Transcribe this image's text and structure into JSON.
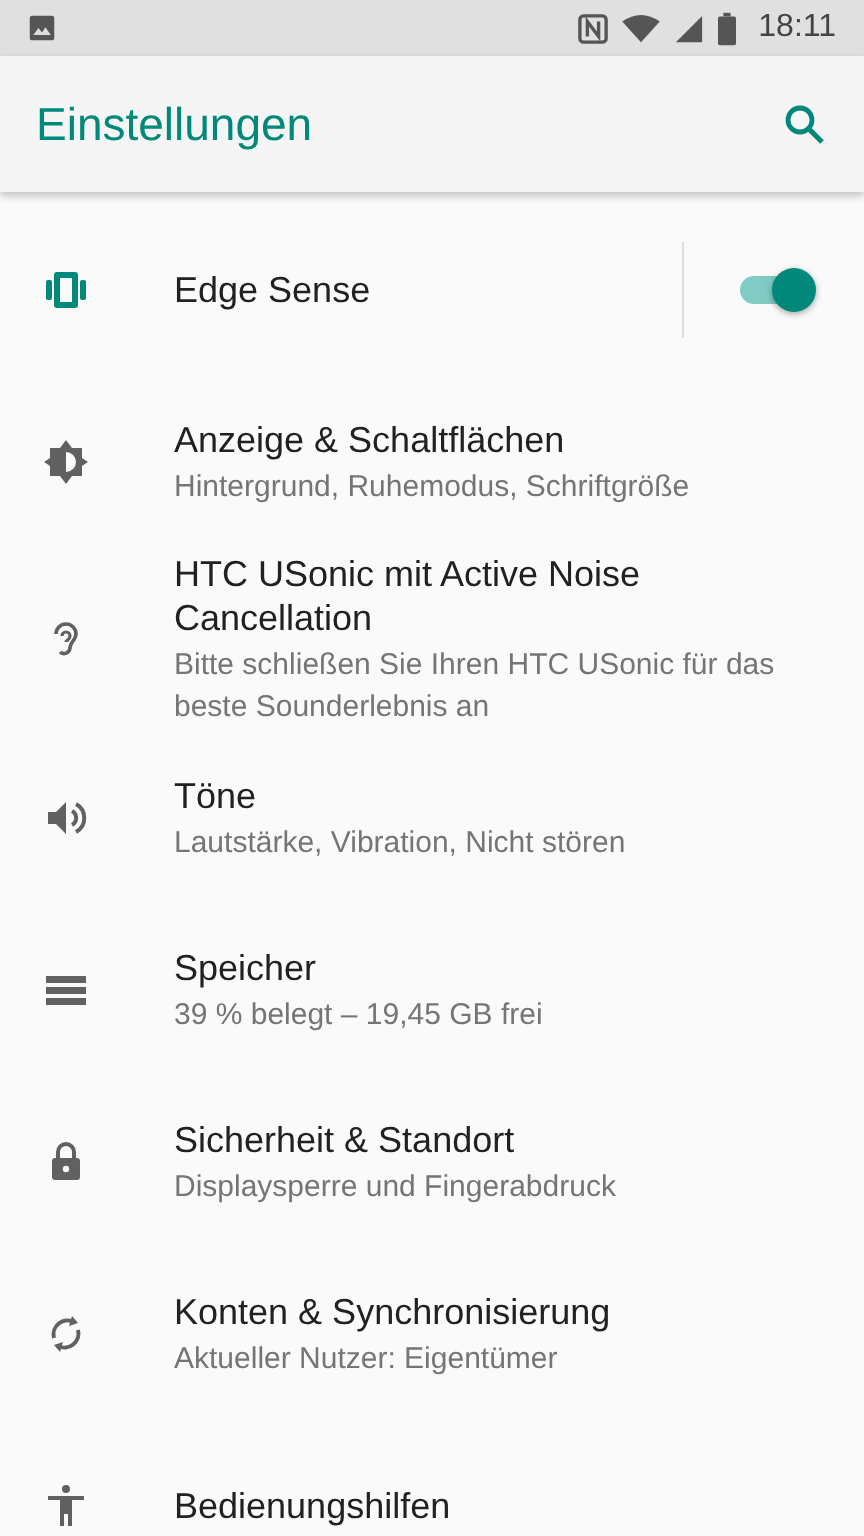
{
  "status_bar": {
    "time": "18:11"
  },
  "app_bar": {
    "title": "Einstellungen"
  },
  "items": [
    {
      "kind": "edge",
      "title": "Edge Sense",
      "toggle": {
        "on": true
      }
    },
    {
      "kind": "brightness",
      "title": "Anzeige & Schaltflächen",
      "subtitle": "Hintergrund, Ruhemodus, Schriftgröße"
    },
    {
      "kind": "ear",
      "title": "HTC USonic mit Active Noise Cancellation",
      "subtitle": "Bitte schließen Sie Ihren HTC USonic für das beste Sounderlebnis an"
    },
    {
      "kind": "volume",
      "title": "Töne",
      "subtitle": "Lautstärke, Vibration, Nicht stören"
    },
    {
      "kind": "storage",
      "title": "Speicher",
      "subtitle": "39 % belegt – 19,45 GB frei"
    },
    {
      "kind": "lock",
      "title": "Sicherheit & Standort",
      "subtitle": "Displaysperre und Fingerabdruck"
    },
    {
      "kind": "sync",
      "title": "Konten & Synchronisierung",
      "subtitle": "Aktueller Nutzer: Eigentümer"
    },
    {
      "kind": "accessibility",
      "title": "Bedienungshilfen"
    }
  ]
}
